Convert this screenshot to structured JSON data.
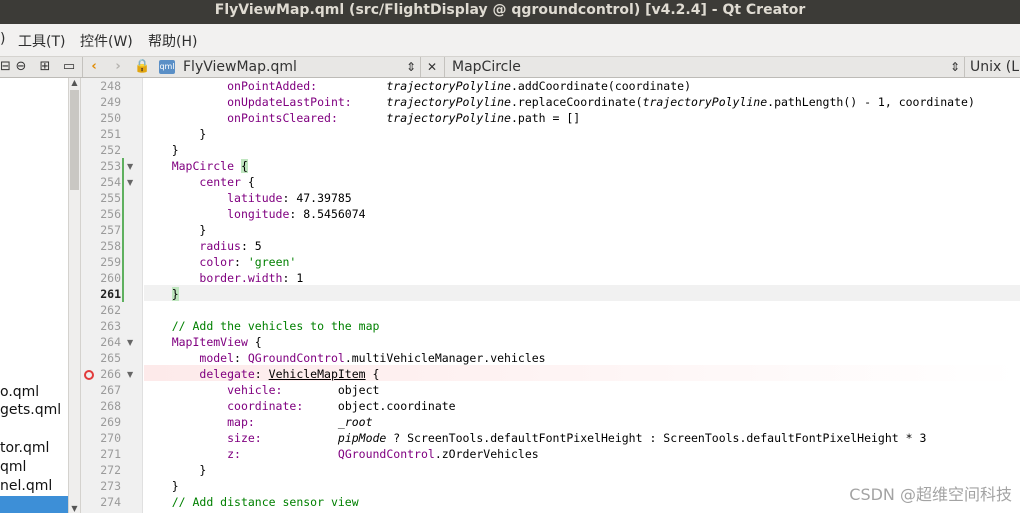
{
  "window": {
    "title": "FlyViewMap.qml (src/FlightDisplay @ qgroundcontrol) [v4.2.4] - Qt Creator"
  },
  "menu": [
    {
      "label": ")"
    },
    {
      "label": "工具(T)"
    },
    {
      "label": "控件(W)"
    },
    {
      "label": "帮助(H)"
    }
  ],
  "toolbar": {
    "file_name": "FlyViewMap.qml",
    "file_type_badge": "qml",
    "symbol": "MapCircle",
    "line_ending": "Unix (LF)",
    "updown_glyph": "⇕",
    "close_glyph": "✕"
  },
  "sidebar": {
    "items": [
      "o.qml",
      "gets.qml",
      "tor.qml",
      "qml",
      "nel.qml"
    ]
  },
  "editor": {
    "current_line": 261,
    "breakpoint_line": 266,
    "lines": [
      {
        "n": 248,
        "fold": ""
      },
      {
        "n": 249,
        "fold": ""
      },
      {
        "n": 250,
        "fold": ""
      },
      {
        "n": 251,
        "fold": ""
      },
      {
        "n": 252,
        "fold": ""
      },
      {
        "n": 253,
        "fold": "▼"
      },
      {
        "n": 254,
        "fold": "▼"
      },
      {
        "n": 255,
        "fold": ""
      },
      {
        "n": 256,
        "fold": ""
      },
      {
        "n": 257,
        "fold": ""
      },
      {
        "n": 258,
        "fold": ""
      },
      {
        "n": 259,
        "fold": ""
      },
      {
        "n": 260,
        "fold": ""
      },
      {
        "n": 261,
        "fold": ""
      },
      {
        "n": 262,
        "fold": ""
      },
      {
        "n": 263,
        "fold": ""
      },
      {
        "n": 264,
        "fold": "▼"
      },
      {
        "n": 265,
        "fold": ""
      },
      {
        "n": 266,
        "fold": "▼"
      },
      {
        "n": 267,
        "fold": ""
      },
      {
        "n": 268,
        "fold": ""
      },
      {
        "n": 269,
        "fold": ""
      },
      {
        "n": 270,
        "fold": ""
      },
      {
        "n": 271,
        "fold": ""
      },
      {
        "n": 272,
        "fold": ""
      },
      {
        "n": 273,
        "fold": ""
      },
      {
        "n": 274,
        "fold": ""
      }
    ],
    "code": {
      "l248_prop": "onPointAdded:",
      "l248_obj": "trajectoryPolyline",
      "l248_rest": ".addCoordinate(coordinate)",
      "l249_prop": "onUpdateLastPoint:",
      "l249_obj": "trajectoryPolyline",
      "l249_mid": ".replaceCoordinate(",
      "l249_obj2": "trajectoryPolyline",
      "l249_rest": ".pathLength() - 1, coordinate)",
      "l250_prop": "onPointsCleared:",
      "l250_obj": "trajectoryPolyline",
      "l250_rest": ".path = []",
      "l251": "}",
      "l252": "}",
      "l253_type": "MapCircle",
      "l253_brace": "{",
      "l254_prop": "center",
      "l254_rest": " {",
      "l255_prop": "latitude",
      "l255_rest": ": 47.39785",
      "l256_prop": "longitude",
      "l256_rest": ": 8.5456074",
      "l257": "}",
      "l258_prop": "radius",
      "l258_rest": ": 5",
      "l259_prop": "color",
      "l259_sep": ": ",
      "l259_str": "'green'",
      "l260_prop": "border.width",
      "l260_rest": ": 1",
      "l261": "}",
      "l263_comment": "// Add the vehicles to the map",
      "l264_type": "MapItemView",
      "l264_rest": " {",
      "l265_prop": "model",
      "l265_sep": ": ",
      "l265_obj": "QGroundControl",
      "l265_rest": ".multiVehicleManager.vehicles",
      "l266_prop": "delegate",
      "l266_sep": ": ",
      "l266_type": "VehicleMapItem",
      "l266_rest": " {",
      "l267_prop": "vehicle:",
      "l267_val": "object",
      "l268_prop": "coordinate:",
      "l268_val": "object.coordinate",
      "l269_prop": "map:",
      "l269_val": "_root",
      "l270_prop": "size:",
      "l270_var": "pipMode",
      "l270_rest": " ? ScreenTools.defaultFontPixelHeight : ScreenTools.defaultFontPixelHeight * 3",
      "l271_prop": "z:",
      "l271_obj": "QGroundControl",
      "l271_rest": ".zOrderVehicles",
      "l272": "}",
      "l273": "}",
      "l274_comment": "// Add distance sensor view"
    }
  },
  "watermark": "CSDN @超维空间科技"
}
